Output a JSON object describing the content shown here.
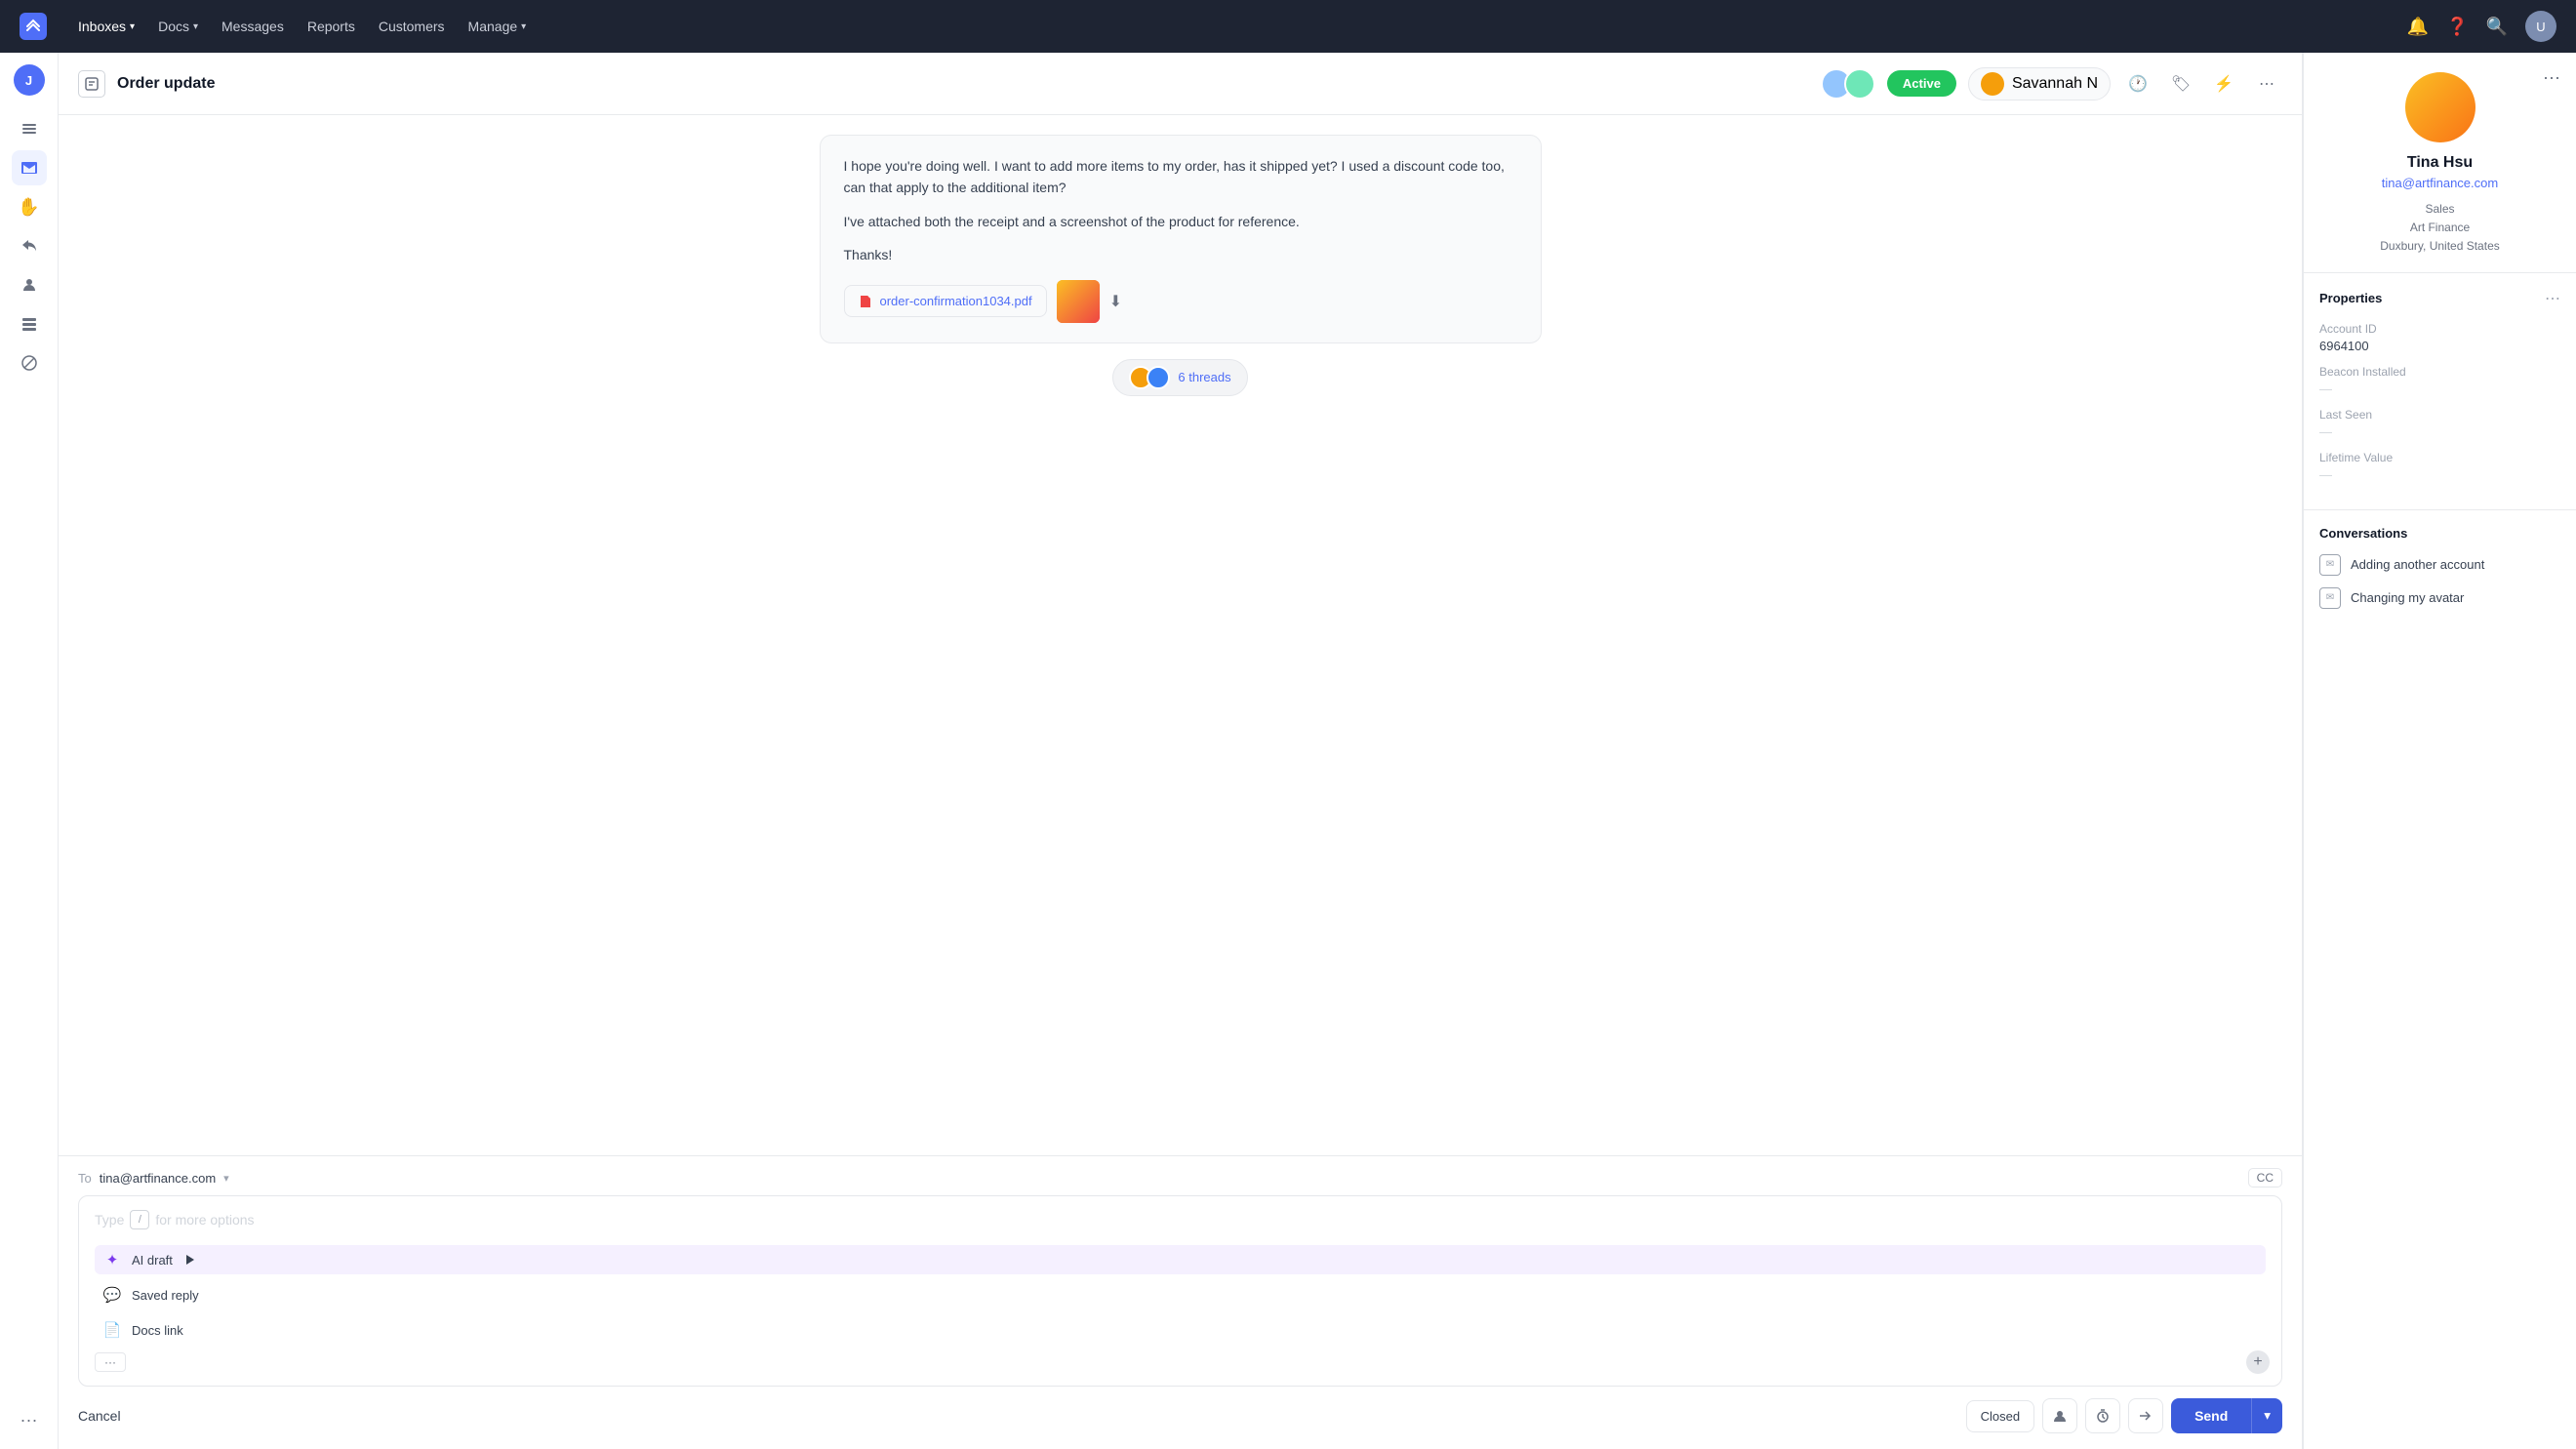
{
  "nav": {
    "logo": "W",
    "items": [
      {
        "label": "Inboxes",
        "hasDropdown": true
      },
      {
        "label": "Docs",
        "hasDropdown": true
      },
      {
        "label": "Messages"
      },
      {
        "label": "Reports"
      },
      {
        "label": "Customers"
      },
      {
        "label": "Manage",
        "hasDropdown": true
      }
    ]
  },
  "sidebar": {
    "items": [
      {
        "icon": "☰",
        "name": "menu-icon"
      },
      {
        "icon": "✉",
        "name": "inbox-icon",
        "active": true
      },
      {
        "icon": "✋",
        "name": "hand-icon"
      },
      {
        "icon": "↩",
        "name": "reply-icon"
      },
      {
        "icon": "👤",
        "name": "contact-icon"
      },
      {
        "icon": "☰",
        "name": "list-icon"
      },
      {
        "icon": "⊘",
        "name": "block-icon"
      },
      {
        "icon": "···",
        "name": "more-icon"
      }
    ]
  },
  "conversation": {
    "title": "Order update",
    "status": "Active",
    "assignee": "Savannah N",
    "threads_count": "6 threads",
    "message": {
      "paragraph1": "I hope you're doing well. I want to add more items to my order, has it shipped yet? I used a discount code too, can that apply to the additional item?",
      "paragraph2": "I've attached both the receipt and a screenshot of the product for reference.",
      "paragraph3": "Thanks!",
      "attachment_name": "order-confirmation1034.pdf"
    },
    "reply": {
      "to_label": "To",
      "to_email": "tina@artfinance.com",
      "placeholder": "Type",
      "placeholder_slash": "/",
      "placeholder_rest": "for more options",
      "ai_draft_label": "AI draft",
      "saved_reply_label": "Saved reply",
      "docs_link_label": "Docs link",
      "more_label": "···"
    },
    "footer": {
      "cancel_label": "Cancel",
      "closed_label": "Closed",
      "send_label": "Send"
    }
  },
  "contact": {
    "name": "Tina Hsu",
    "email": "tina@artfinance.com",
    "role": "Sales",
    "company": "Art Finance",
    "location": "Duxbury, United States",
    "properties_title": "Properties",
    "account_id_label": "Account ID",
    "account_id_value": "6964100",
    "beacon_label": "Beacon Installed",
    "beacon_value": "—",
    "last_seen_label": "Last Seen",
    "last_seen_value": "—",
    "lifetime_label": "Lifetime Value",
    "lifetime_value": "—",
    "conversations_title": "Conversations",
    "conv_items": [
      {
        "label": "Adding another account"
      },
      {
        "label": "Changing my avatar"
      }
    ]
  }
}
